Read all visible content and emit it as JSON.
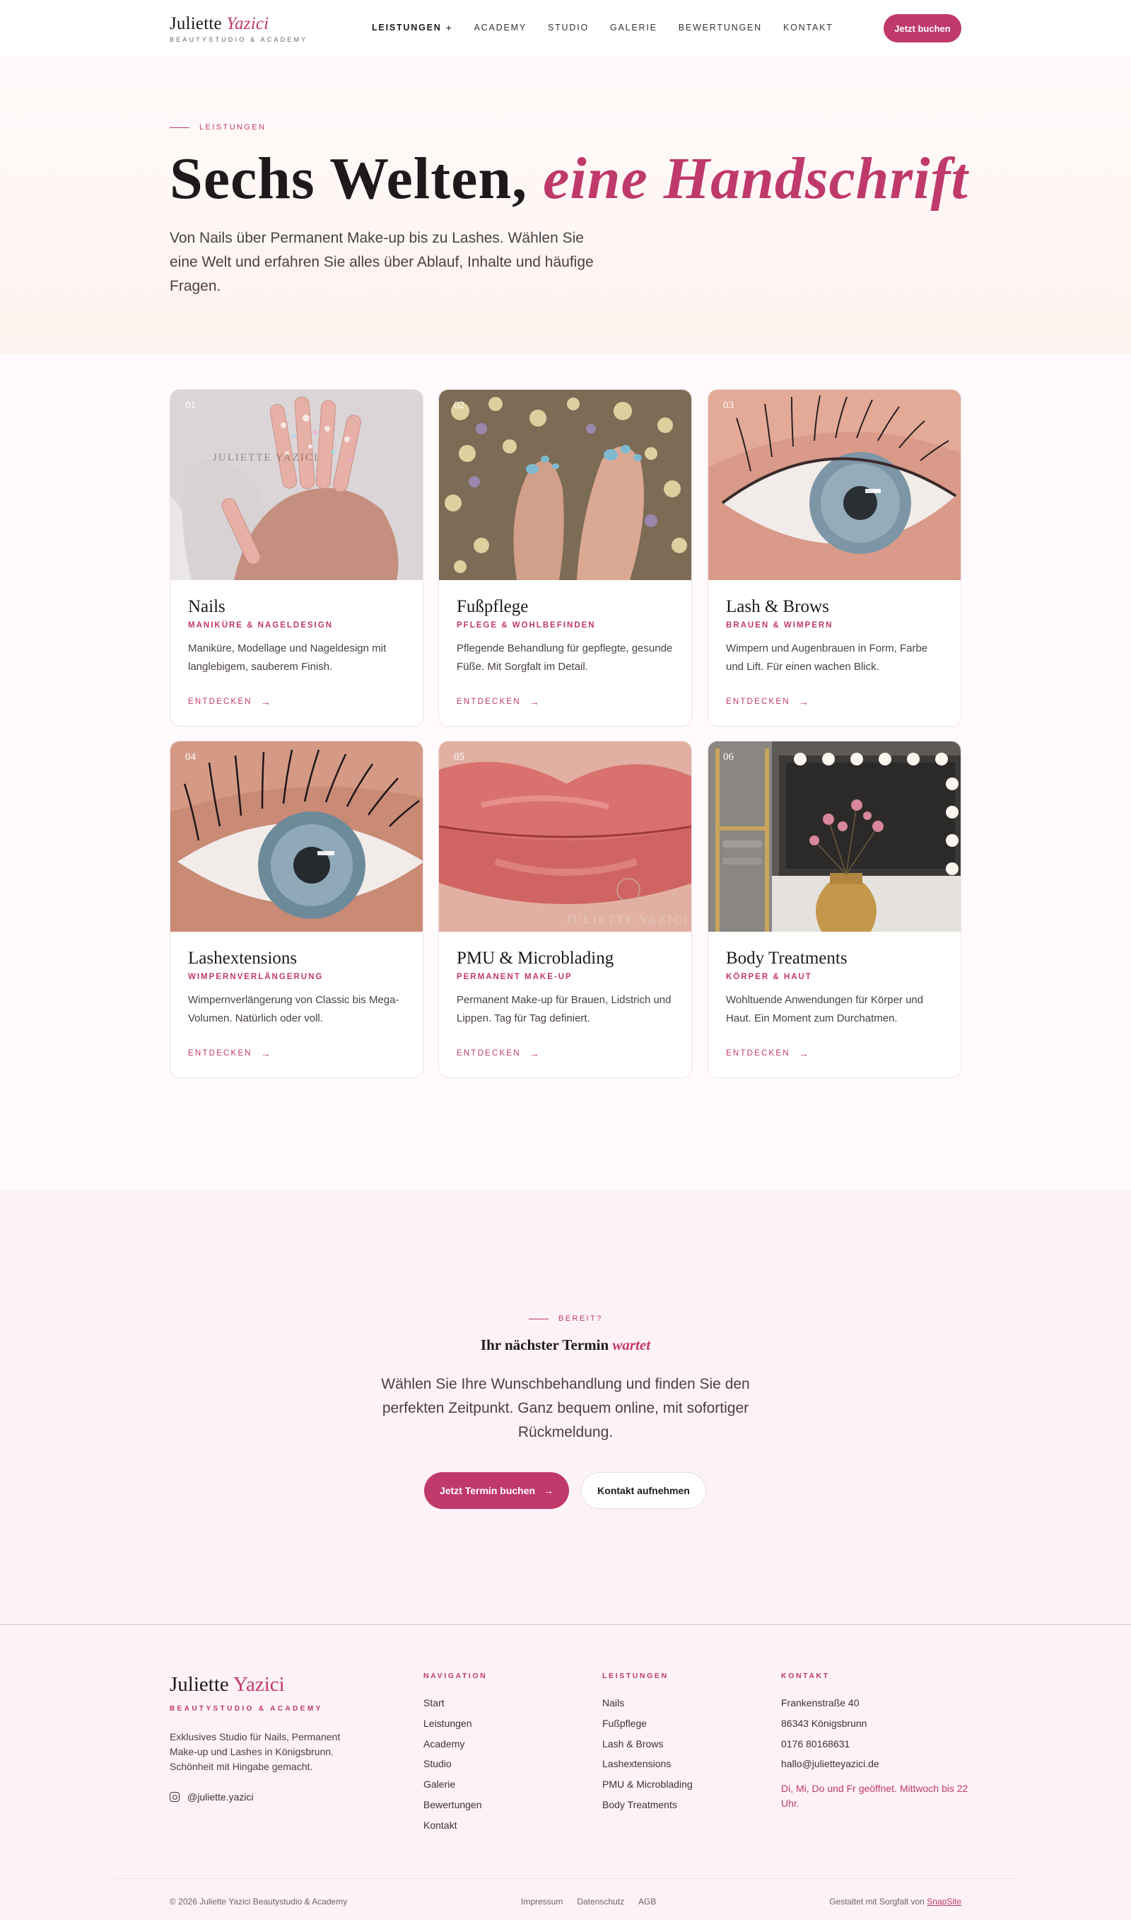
{
  "header": {
    "logo_first": "Juliette",
    "logo_last": "Yazici",
    "logo_tagline": "BEAUTYSTUDIO & ACADEMY",
    "nav": [
      "LEISTUNGEN",
      "ACADEMY",
      "STUDIO",
      "GALERIE",
      "BEWERTUNGEN",
      "KONTAKT"
    ],
    "cta": "Jetzt buchen"
  },
  "hero": {
    "eyebrow": "LEISTUNGEN",
    "title_plain": "Sechs Welten,",
    "title_accent": "eine Handschrift",
    "text": "Von Nails über Permanent Make-up bis zu Lashes. Wählen Sie eine Welt und erfahren Sie alles über Ablauf, Inhalte und häufige Fragen."
  },
  "services": [
    {
      "num": "01",
      "title": "Nails",
      "subtitle": "MANIKÜRE & NAGELDESIGN",
      "desc": "Maniküre, Modellage und Nageldesign mit langlebigem, sauberem Finish.",
      "link": "ENTDECKEN"
    },
    {
      "num": "02",
      "title": "Fußpflege",
      "subtitle": "PFLEGE & WOHLBEFINDEN",
      "desc": "Pflegende Behandlung für gepflegte, gesunde Füße. Mit Sorgfalt im Detail.",
      "link": "ENTDECKEN"
    },
    {
      "num": "03",
      "title": "Lash & Brows",
      "subtitle": "BRAUEN & WIMPERN",
      "desc": "Wimpern und Augenbrauen in Form, Farbe und Lift. Für einen wachen Blick.",
      "link": "ENTDECKEN"
    },
    {
      "num": "04",
      "title": "Lashextensions",
      "subtitle": "WIMPERNVERLÄNGERUNG",
      "desc": "Wimpernverlängerung von Classic bis Mega-Volumen. Natürlich oder voll.",
      "link": "ENTDECKEN"
    },
    {
      "num": "05",
      "title": "PMU & Microblading",
      "subtitle": "PERMANENT MAKE-UP",
      "desc": "Permanent Make-up für Brauen, Lidstrich und Lippen. Tag für Tag definiert.",
      "link": "ENTDECKEN"
    },
    {
      "num": "06",
      "title": "Body Treatments",
      "subtitle": "KÖRPER & HAUT",
      "desc": "Wohltuende Anwendungen für Körper und Haut. Ein Moment zum Durchatmen.",
      "link": "ENTDECKEN"
    }
  ],
  "image_text": {
    "nails_watermark": "JULIETTE YAZICI",
    "lips_watermark": "JULIETTE YAZICI"
  },
  "cta": {
    "eyebrow": "BEREIT?",
    "title_plain": "Ihr nächster Termin",
    "title_accent": "wartet",
    "text": "Wählen Sie Ihre Wunschbehandlung und finden Sie den perfekten Zeitpunkt. Ganz bequem online, mit sofortiger Rückmeldung.",
    "primary": "Jetzt Termin buchen",
    "secondary": "Kontakt aufnehmen"
  },
  "footer": {
    "logo_first": "Juliette",
    "logo_last": "Yazici",
    "tagline": "BEAUTYSTUDIO & ACADEMY",
    "desc": "Exklusives Studio für Nails, Permanent Make-up und Lashes in Königsbrunn. Schönheit mit Hingabe gemacht.",
    "instagram": "@juliette.yazici",
    "nav_title": "NAVIGATION",
    "nav": [
      "Start",
      "Leistungen",
      "Academy",
      "Studio",
      "Galerie",
      "Bewertungen",
      "Kontakt"
    ],
    "services_title": "LEISTUNGEN",
    "services": [
      "Nails",
      "Fußpflege",
      "Lash & Brows",
      "Lashextensions",
      "PMU & Microblading",
      "Body Treatments"
    ],
    "contact_title": "KONTAKT",
    "street": "Frankenstraße 40",
    "city": "86343 Königsbrunn",
    "phone": "0176 80168631",
    "email": "hallo@julietteyazici.de",
    "hours": "Di, Mi, Do und Fr geöffnet. Mittwoch bis 22 Uhr.",
    "copyright": "© 2026 Juliette Yazici Beautystudio & Academy",
    "legal": [
      "Impressum",
      "Datenschutz",
      "AGB"
    ],
    "credit_prefix": "Gestaltet mit Sorgfalt von",
    "credit_link": "SnapSite"
  },
  "colors": {
    "accent": "#c0396b",
    "text": "#1e1a1c",
    "body_bg": "#fffafb",
    "cta_bg": "#fdf2f5"
  }
}
